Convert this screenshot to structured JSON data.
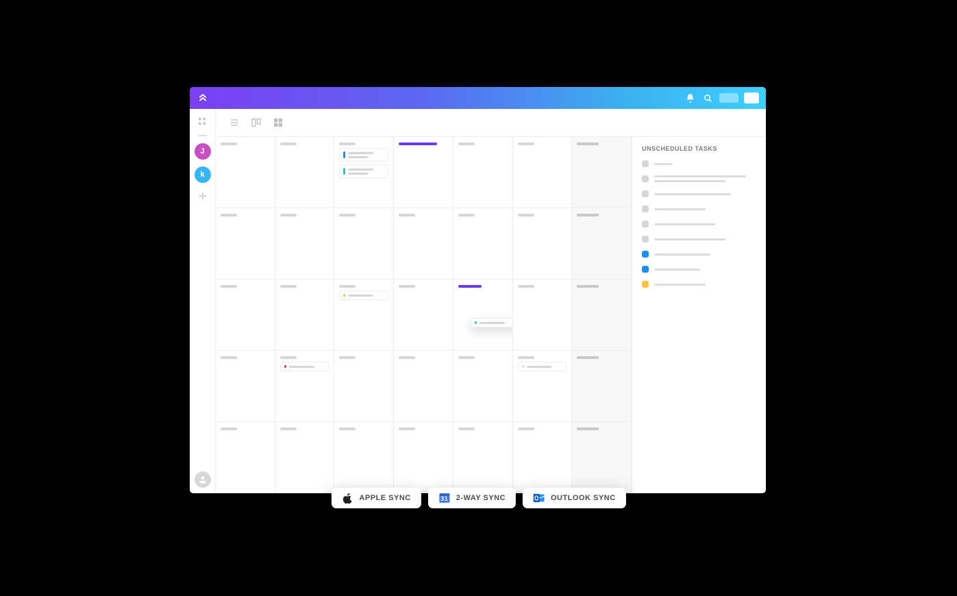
{
  "colors": {
    "purple": "#6a3cf0",
    "blue": "#1d8eff",
    "cyan": "#19d3b5",
    "yellow": "#ffc53d",
    "red": "#e23b3b",
    "grey": "#d6d6d6"
  },
  "sidebar": {
    "members": [
      {
        "initial": "J",
        "bg": "#c94fc4"
      },
      {
        "initial": "k",
        "bg": "#35b6f2"
      }
    ]
  },
  "right_panel": {
    "title": "UNSCHEDULED TASKS",
    "items": [
      {
        "color": "#d6d6d6",
        "w1": 18,
        "w2": 0
      },
      {
        "color": "#d6d6d6",
        "w1": 90,
        "w2": 70
      },
      {
        "color": "#d6d6d6",
        "w1": 75,
        "w2": 0
      },
      {
        "color": "#d6d6d6",
        "w1": 50,
        "w2": 0
      },
      {
        "color": "#d6d6d6",
        "w1": 60,
        "w2": 0
      },
      {
        "color": "#d6d6d6",
        "w1": 70,
        "w2": 0
      },
      {
        "color": "#1d8eff",
        "w1": 55,
        "w2": 0
      },
      {
        "color": "#1d8eff",
        "w1": 45,
        "w2": 0
      },
      {
        "color": "#ffc53d",
        "w1": 50,
        "w2": 0
      }
    ]
  },
  "calendar": {
    "rows": 5,
    "cols": 7,
    "cells": [
      {
        "row": 0,
        "col": 3,
        "accent": "purple"
      },
      {
        "row": 2,
        "col": 4,
        "accent": "purple"
      }
    ],
    "cards": [
      {
        "row": 0,
        "col": 2,
        "stripe": "#1d8eff",
        "lines": 2
      },
      {
        "row": 0,
        "col": 2,
        "stripe": "#19d3b5",
        "lines": 2
      },
      {
        "row": 2,
        "col": 2,
        "stripe": "#ffc53d",
        "lines": 1
      },
      {
        "row": 2,
        "col": 4,
        "stripe": "#19d3b5",
        "lines": 1,
        "dragging": true
      },
      {
        "row": 3,
        "col": 1,
        "stripe": "#e23b3b",
        "lines": 1
      },
      {
        "row": 3,
        "col": 5,
        "stripe": "#d6d6d6",
        "lines": 1
      }
    ]
  },
  "pills": {
    "apple": "APPLE SYNC",
    "google": "2-WAY SYNC",
    "google_day": "31",
    "outlook": "OUTLOOK SYNC"
  }
}
